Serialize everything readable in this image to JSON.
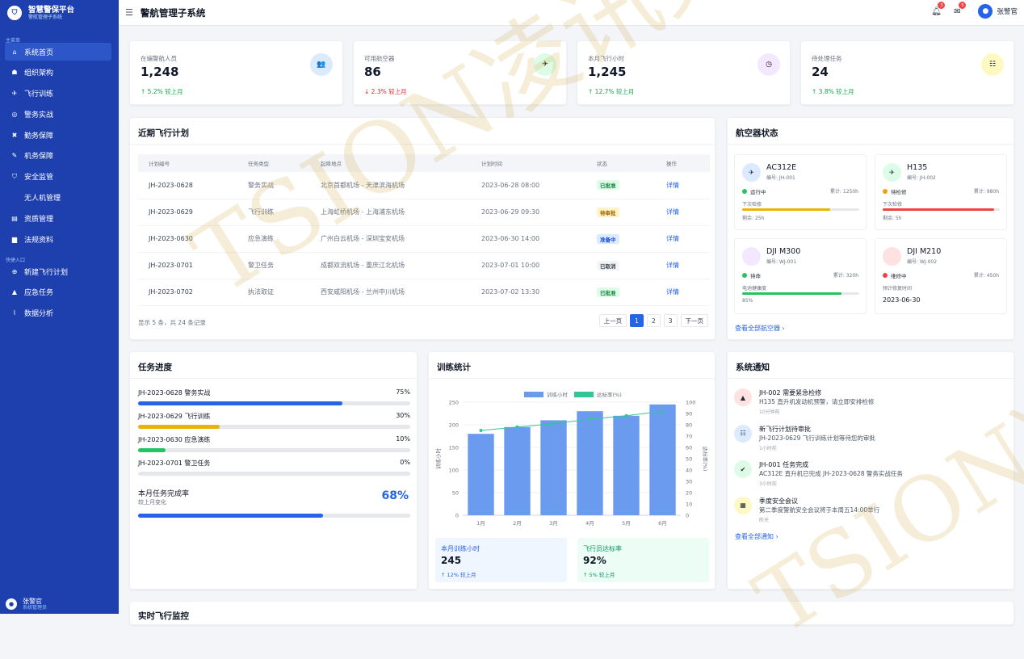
{
  "brand": {
    "title": "智慧警保平台",
    "subtitle": "警航管理子系统"
  },
  "sidebar": {
    "main_section": "主菜单",
    "items": [
      {
        "label": "系统首页",
        "icon": "home-icon",
        "glyph": "⌂",
        "active": true
      },
      {
        "label": "组织架构",
        "icon": "org-chart-icon",
        "glyph": "☗"
      },
      {
        "label": "飞行训练",
        "icon": "plane-icon",
        "glyph": "✈"
      },
      {
        "label": "警务实战",
        "icon": "target-icon",
        "glyph": "◎"
      },
      {
        "label": "勤务保障",
        "icon": "tools-icon",
        "glyph": "✖"
      },
      {
        "label": "机务保障",
        "icon": "wrench-icon",
        "glyph": "✎"
      },
      {
        "label": "安全监管",
        "icon": "shield-icon",
        "glyph": "⛉"
      },
      {
        "label": "无人机管理",
        "icon": "",
        "glyph": "",
        "sub": true
      },
      {
        "label": "资质管理",
        "icon": "id-card-icon",
        "glyph": "▤"
      },
      {
        "label": "法规资料",
        "icon": "book-icon",
        "glyph": "▆"
      }
    ],
    "quick_section": "快捷入口",
    "quick": [
      {
        "label": "新建飞行计划",
        "icon": "plus-circle-icon",
        "glyph": "⊕"
      },
      {
        "label": "应急任务",
        "icon": "warning-icon",
        "glyph": "▲"
      },
      {
        "label": "数据分析",
        "icon": "line-chart-icon",
        "glyph": "⌇"
      }
    ],
    "user": {
      "name": "张警官",
      "role": "系统管理员"
    }
  },
  "topbar": {
    "title": "警航管理子系统",
    "bell_count": "3",
    "mail_count": "5",
    "user": "张警官"
  },
  "stats": [
    {
      "label": "在编警航人员",
      "value": "1,248",
      "trend": "↑ 5.2% 较上月",
      "dir": "up",
      "icon": "users-icon",
      "glyph": "👥",
      "bg": "#dbeafe"
    },
    {
      "label": "可用航空器",
      "value": "86",
      "trend": "↓ 2.3% 较上月",
      "dir": "down",
      "icon": "helicopter-icon",
      "glyph": "✈",
      "bg": "#dcfce7"
    },
    {
      "label": "本月飞行小时",
      "value": "1,245",
      "trend": "↑ 12.7% 较上月",
      "dir": "up",
      "icon": "clock-icon",
      "glyph": "◷",
      "bg": "#f3e8ff"
    },
    {
      "label": "待处理任务",
      "value": "24",
      "trend": "↑ 3.8% 较上月",
      "dir": "up",
      "icon": "list-icon",
      "glyph": "☷",
      "bg": "#fef9c3"
    }
  ],
  "flight_plans": {
    "title": "近期飞行计划",
    "columns": [
      "计划编号",
      "任务类型",
      "起降地点",
      "计划时间",
      "状态",
      "操作"
    ],
    "rows": [
      {
        "id": "JH-2023-0628",
        "type": "警务实战",
        "route": "北京首都机场 - 天津滨海机场",
        "time": "2023-06-28 08:00",
        "status": "已批准",
        "status_fg": "#15803d",
        "status_bg": "#dcfce7",
        "action": "详情"
      },
      {
        "id": "JH-2023-0629",
        "type": "飞行训练",
        "route": "上海虹桥机场 - 上海浦东机场",
        "time": "2023-06-29 09:30",
        "status": "待审批",
        "status_fg": "#a16207",
        "status_bg": "#fef3c7",
        "action": "详情"
      },
      {
        "id": "JH-2023-0630",
        "type": "应急演练",
        "route": "广州白云机场 - 深圳宝安机场",
        "time": "2023-06-30 14:00",
        "status": "准备中",
        "status_fg": "#1d4ed8",
        "status_bg": "#dbeafe",
        "action": "详情"
      },
      {
        "id": "JH-2023-0701",
        "type": "警卫任务",
        "route": "成都双流机场 - 重庆江北机场",
        "time": "2023-07-01 10:00",
        "status": "已取消",
        "status_fg": "#374151",
        "status_bg": "#f3f4f6",
        "action": "详情"
      },
      {
        "id": "JH-2023-0702",
        "type": "执法取证",
        "route": "西安咸阳机场 - 兰州中川机场",
        "time": "2023-07-02 13:30",
        "status": "已批准",
        "status_fg": "#15803d",
        "status_bg": "#dcfce7",
        "action": "详情"
      }
    ],
    "info": "显示 5 条，共 24 条记录",
    "prev": "上一页",
    "pages": [
      "1",
      "2",
      "3"
    ],
    "next": "下一页"
  },
  "aircraft": {
    "title": "航空器状态",
    "items": [
      {
        "name": "AC312E",
        "code": "编号: JH-001",
        "status": "运行中",
        "dot": "#22c55e",
        "total": "累计: 1250h",
        "sublabel": "下次检修",
        "progress": 0.75,
        "bar": "#eab308",
        "subtext": "剩余: 25h",
        "icon": "helicopter-icon",
        "icon_bg": "#dbeafe"
      },
      {
        "name": "H135",
        "code": "编号: JH-002",
        "status": "待检修",
        "dot": "#f59e0b",
        "total": "累计: 980h",
        "sublabel": "下次检修",
        "progress": 0.95,
        "bar": "#ef4444",
        "subtext": "剩余: 5h",
        "icon": "helicopter-icon",
        "icon_bg": "#dcfce7"
      },
      {
        "name": "DJI M300",
        "code": "编号: WJ-001",
        "status": "待命",
        "dot": "#22c55e",
        "total": "累计: 320h",
        "sublabel": "电池健康度",
        "progress": 0.85,
        "bar": "#22c55e",
        "subtext": "85%",
        "icon": "drone-icon",
        "icon_bg": "#f3e8ff"
      },
      {
        "name": "DJI M210",
        "code": "编号: WJ-002",
        "status": "维修中",
        "dot": "#ef4444",
        "total": "累计: 450h",
        "sublabel": "预计修复时间",
        "date": "2023-06-30",
        "icon": "drone-icon",
        "icon_bg": "#fee2e2"
      }
    ],
    "view_all": "查看全部航空器 ›"
  },
  "tasks": {
    "title": "任务进度",
    "items": [
      {
        "label": "JH-2023-0628 警务实战",
        "percent": "75%",
        "value": 0.75,
        "color": "#2563eb"
      },
      {
        "label": "JH-2023-0629 飞行训练",
        "percent": "30%",
        "value": 0.3,
        "color": "#eab308"
      },
      {
        "label": "JH-2023-0630 应急演练",
        "percent": "10%",
        "value": 0.1,
        "color": "#22c55e"
      },
      {
        "label": "JH-2023-0701 警卫任务",
        "percent": "0%",
        "value": 0,
        "color": "#9ca3af"
      }
    ],
    "monthly_label": "本月任务完成率",
    "monthly_sub": "较上月变化",
    "monthly_value": "68%",
    "monthly_progress": 0.68
  },
  "training": {
    "title": "训练统计",
    "mini": [
      {
        "label": "本月训练小时",
        "value": "245",
        "trend": "↑ 12% 较上月",
        "bg": "#eff6ff",
        "fg": "#2563eb"
      },
      {
        "label": "飞行员达标率",
        "value": "92%",
        "trend": "↑ 5% 较上月",
        "bg": "#ecfdf5",
        "fg": "#059669"
      }
    ]
  },
  "chart_data": {
    "type": "bar",
    "categories": [
      "1月",
      "2月",
      "3月",
      "4月",
      "5月",
      "6月"
    ],
    "series": [
      {
        "name": "训练小时",
        "type": "bar",
        "values": [
          180,
          195,
          210,
          230,
          220,
          245
        ],
        "color": "#6b9bee"
      },
      {
        "name": "达标率(%)",
        "type": "line",
        "values": [
          75,
          78,
          81,
          85,
          88,
          92
        ],
        "color": "#34c597"
      }
    ],
    "ylabel": "训练小时",
    "y2label": "达标率(%)",
    "ylim": [
      0,
      250
    ],
    "y2lim": [
      0,
      100
    ],
    "yticks": [
      "250",
      "200",
      "150",
      "100",
      "50",
      "0"
    ],
    "y2ticks": [
      "100",
      "90",
      "80",
      "70",
      "60",
      "50",
      "40",
      "30",
      "20",
      "10",
      "0"
    ],
    "legend": "top-center",
    "grid": true
  },
  "notices": {
    "title": "系统通知",
    "items": [
      {
        "title": "JH-002 需要紧急检修",
        "desc": "H135 直升机发动机预警，请立即安排检修",
        "time": "10分钟前",
        "icon": "alert-icon",
        "glyph": "▲",
        "bg": "#fee2e2",
        "fg": "#1f2937"
      },
      {
        "title": "新飞行计划待审批",
        "desc": "JH-2023-0629 飞行训练计划等待您的审批",
        "time": "1小时前",
        "icon": "list-icon",
        "glyph": "☷",
        "bg": "#dbeafe",
        "fg": "#1f2937"
      },
      {
        "title": "JH-001 任务完成",
        "desc": "AC312E 直升机已完成 JH-2023-0628 警务实战任务",
        "time": "3小时前",
        "icon": "check-icon",
        "glyph": "✔",
        "bg": "#dcfce7",
        "fg": "#1f2937"
      },
      {
        "title": "季度安全会议",
        "desc": "第二季度警航安全会议将于本周五14:00举行",
        "time": "昨天",
        "icon": "calendar-icon",
        "glyph": "▦",
        "bg": "#fef9c3",
        "fg": "#1f2937"
      }
    ],
    "view_all": "查看全部通知 ›"
  },
  "realtime": {
    "title": "实时飞行监控"
  },
  "watermark": {
    "text": "TSION凌讯数字"
  }
}
